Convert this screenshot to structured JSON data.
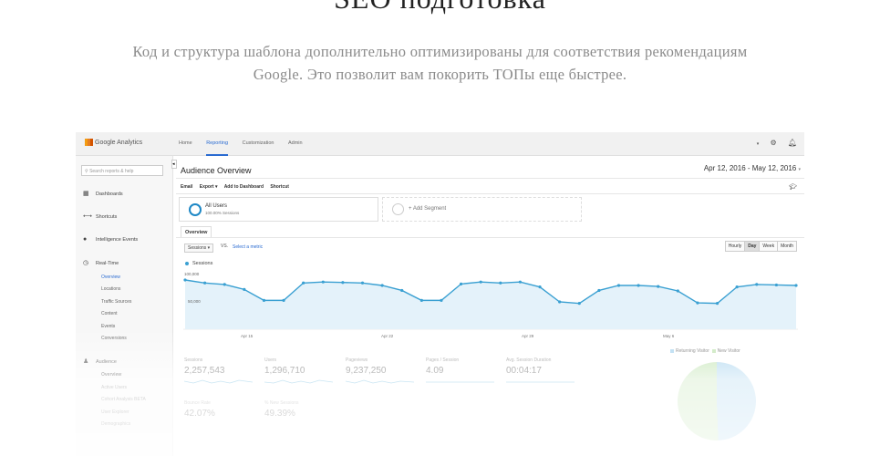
{
  "hero": {
    "title": "SEO подготовка",
    "text": "Код и структура шаблона дополнительно оптимизированы для соответствия рекомендациям Google. Это позволит вам покорить ТОПы еще быстрее."
  },
  "ga": {
    "logo": "Google Analytics",
    "nav": [
      "Home",
      "Reporting",
      "Customization",
      "Admin"
    ],
    "active_nav": "Reporting",
    "search_placeholder": "Search reports & help",
    "sidebar": {
      "items": [
        {
          "label": "Dashboards",
          "icon": "grid-icon"
        },
        {
          "label": "Shortcuts",
          "icon": "arrows-icon"
        },
        {
          "label": "Intelligence Events",
          "icon": "bulb-icon"
        },
        {
          "label": "Real-Time",
          "icon": "clock-icon"
        },
        {
          "label": "Audience",
          "icon": "people-icon"
        }
      ],
      "realtime_sub": [
        "Overview",
        "Locations",
        "Traffic Sources",
        "Content",
        "Events",
        "Conversions"
      ],
      "audience_sub": [
        "Overview",
        "Active Users",
        "Cohort Analysis BETA",
        "User Explorer",
        "Demographics"
      ]
    },
    "page_title": "Audience Overview",
    "date_range": "Apr 12, 2016 - May 12, 2016",
    "actions": [
      "Email",
      "Export ▾",
      "Add to Dashboard",
      "Shortcut"
    ],
    "segments": {
      "all_users": "All Users",
      "all_users_sub": "100.00% Sessions",
      "add_segment": "+ Add Segment"
    },
    "tab": "Overview",
    "metric": "Sessions",
    "vs": "VS.",
    "select_metric": "Select a metric",
    "granularity": [
      "Hourly",
      "Day",
      "Week",
      "Month"
    ],
    "active_granularity": "Day",
    "legend": "Sessions",
    "kpis": [
      {
        "label": "Sessions",
        "value": "2,257,543"
      },
      {
        "label": "Users",
        "value": "1,296,710"
      },
      {
        "label": "Pageviews",
        "value": "9,237,250"
      },
      {
        "label": "Pages / Session",
        "value": "4.09"
      },
      {
        "label": "Avg. Session Duration",
        "value": "00:04:17"
      },
      {
        "label": "Bounce Rate",
        "value": "42.07%"
      },
      {
        "label": "% New Sessions",
        "value": "49.39%"
      }
    ],
    "pie": {
      "legend": [
        "Returning Visitor",
        "New Visitor"
      ],
      "values": [
        49.39,
        50.61
      ],
      "colors": [
        "#a7d3ee",
        "#bfe3b0"
      ]
    }
  },
  "chart_data": {
    "type": "line",
    "title": "",
    "series": [
      {
        "name": "Sessions",
        "values": [
          99000,
          93000,
          90000,
          80000,
          58000,
          58000,
          93000,
          95000,
          94000,
          93000,
          88000,
          78000,
          58000,
          58000,
          91000,
          95000,
          93000,
          95000,
          85000,
          55000,
          52000,
          78000,
          88000,
          88000,
          86000,
          77000,
          53000,
          52000,
          85000,
          90000,
          89000,
          88000
        ]
      }
    ],
    "x_ticks": [
      "Apr 15",
      "Apr 22",
      "Apr 29",
      "May 6"
    ],
    "y_ticks": [
      "100,000",
      "50,000"
    ],
    "ylim": [
      0,
      110000
    ],
    "color": "#3aa0d2"
  }
}
